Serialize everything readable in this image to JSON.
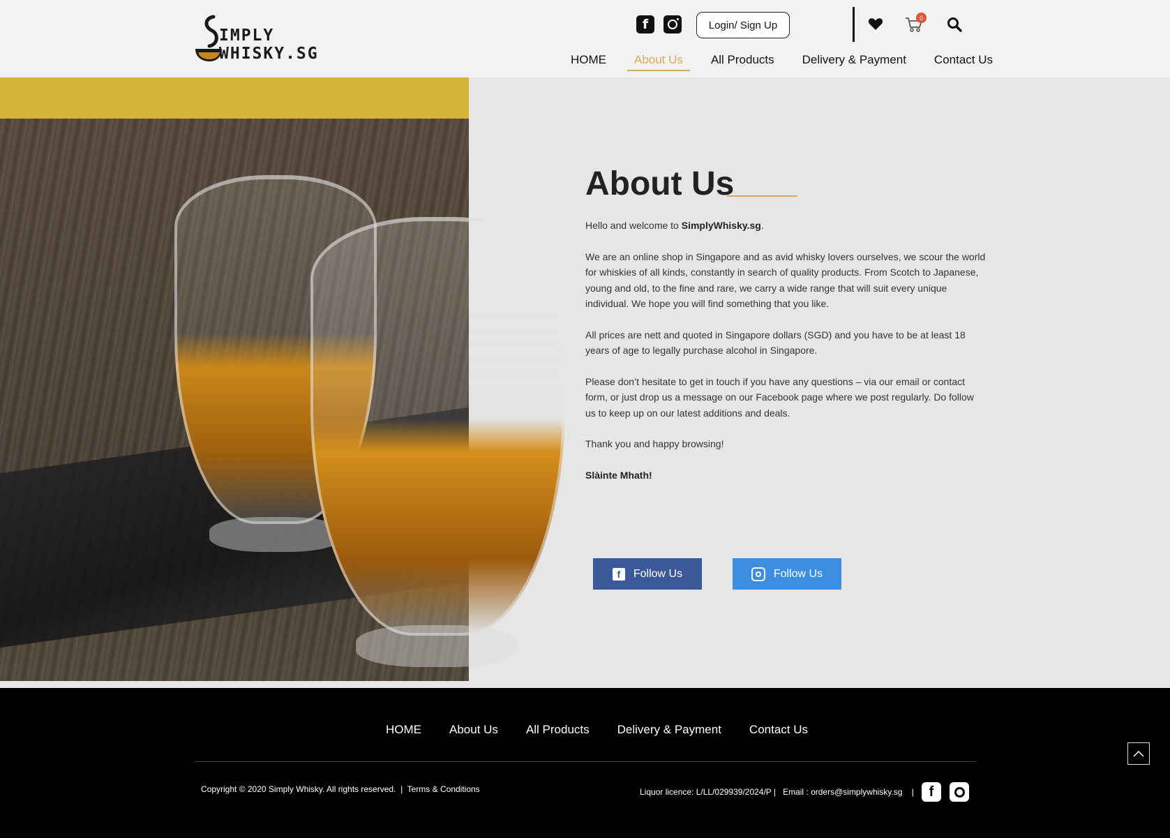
{
  "header": {
    "logo_line1": "IMPLY",
    "logo_line2": "WHISKY.SG",
    "login_label": "Login/ Sign Up",
    "cart_count": "0",
    "nav": [
      {
        "label": "HOME"
      },
      {
        "label": "About Us"
      },
      {
        "label": "All Products"
      },
      {
        "label": "Delivery & Payment"
      },
      {
        "label": "Contact Us"
      }
    ],
    "active_nav": "About Us"
  },
  "main": {
    "title": "About Us",
    "intro_prefix": "Hello and welcome to ",
    "intro_brand": "SimplyWhisky.sg",
    "intro_suffix": ".",
    "paragraph_1": "We are an online shop in Singapore and as avid whisky lovers ourselves, we scour the world for whiskies of all kinds, constantly in search of quality products. From Scotch to Japanese, young and old, to the fine and rare, we carry a wide range that will suit every unique individual. We hope you will find something that you like.",
    "paragraph_2": "All prices are nett and quoted in Singapore dollars (SGD) and you have to be at least 18 years of age to legally purchase alcohol in Singapore.",
    "paragraph_3": "Please don’t hesitate to get in touch if you have any questions – via our email or contact form, or just drop us a message on our Facebook page where we post regularly. Do follow us to keep up on our latest additions and deals.",
    "paragraph_4": "Thank you and happy browsing!",
    "signoff": "Slàinte Mhath!",
    "follow_facebook_label": "Follow Us",
    "follow_instagram_label": "Follow Us"
  },
  "footer": {
    "nav": [
      {
        "label": "HOME"
      },
      {
        "label": "About Us"
      },
      {
        "label": "All Products"
      },
      {
        "label": "Delivery & Payment"
      },
      {
        "label": "Contact Us"
      }
    ],
    "copyright": "Copyright © 2020 Simply Whisky. All rights reserved.",
    "copyright_sep": "|",
    "terms": "Terms & Conditions",
    "licence": "Liquor licence: L/LL/029939/2024/P |",
    "email_prefix": "Email : ",
    "email": "orders@simplywhisky.sg",
    "email_sep": "|"
  },
  "colors": {
    "accent": "#d9a85a",
    "facebook_button": "#3b5998",
    "instagram_button": "#3c8ee0",
    "cart_badge": "#e0543a",
    "footer_bg": "#000000"
  },
  "icons": [
    "facebook-icon",
    "instagram-icon",
    "heart-icon",
    "cart-icon",
    "search-icon",
    "scroll-top-icon"
  ]
}
